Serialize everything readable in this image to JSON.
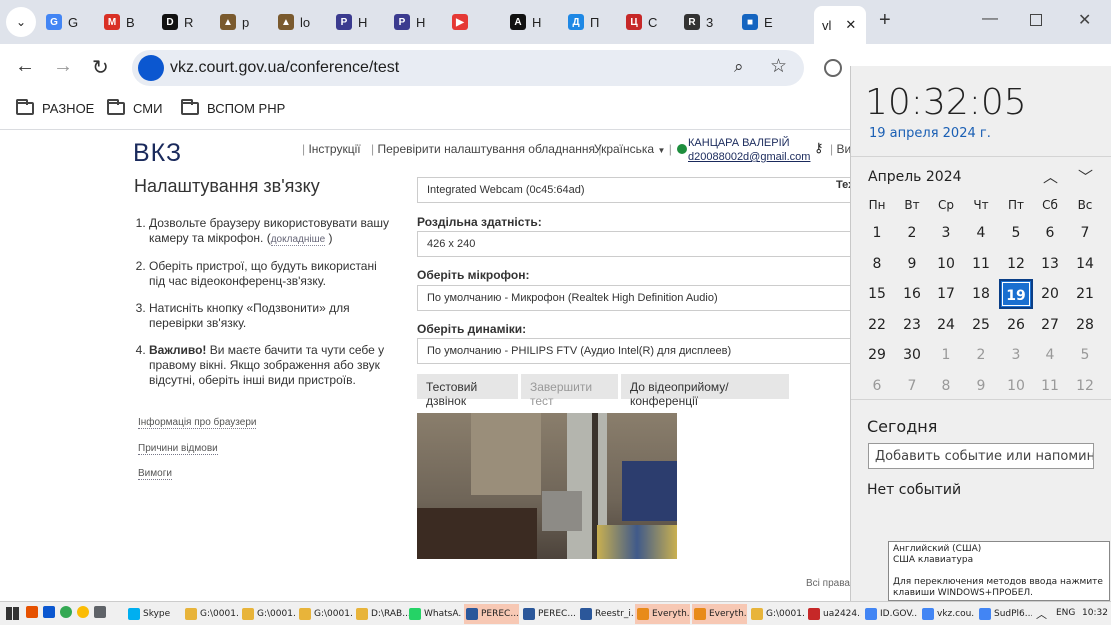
{
  "browser": {
    "tabs": [
      {
        "label": "G",
        "color": "#4285f4",
        "glyph": "G"
      },
      {
        "label": "B",
        "color": "#d93025",
        "glyph": "M"
      },
      {
        "label": "R",
        "color": "#111111",
        "glyph": "D"
      },
      {
        "label": "p",
        "color": "#7a5a2e",
        "glyph": "▲"
      },
      {
        "label": "lo",
        "color": "#7a5a2e",
        "glyph": "▲"
      },
      {
        "label": "H",
        "color": "#3b3b8f",
        "glyph": "P"
      },
      {
        "label": "H",
        "color": "#3b3b8f",
        "glyph": "P"
      },
      {
        "label": "",
        "color": "#e53935",
        "glyph": "▶"
      },
      {
        "label": "H",
        "color": "#111111",
        "glyph": "A"
      },
      {
        "label": "П",
        "color": "#1e88e5",
        "glyph": "Д"
      },
      {
        "label": "С",
        "color": "#c62828",
        "glyph": "Ц"
      },
      {
        "label": "3",
        "color": "#333333",
        "glyph": "R"
      },
      {
        "label": "Е",
        "color": "#1565c0",
        "glyph": "■"
      },
      {
        "label": "vl",
        "color": "#ffffff",
        "glyph": ""
      }
    ],
    "close_tab": "✕",
    "new_tab": "+",
    "url": "vkz.court.gov.ua/conference/test",
    "bookmarks": [
      "РАЗНОЕ",
      "СМИ",
      "ВСПОМ РНР"
    ]
  },
  "site": {
    "logo": "ВКЗ",
    "nav": [
      "Інструкції",
      "Перевірити налаштування обладнання",
      "Українська",
      "Ви"
    ],
    "user_name": "КАНЦАРА ВАЛЕРІЙ",
    "user_email": "d20088002d@gmail.com",
    "title": "Налаштування зв'язку",
    "steps": [
      {
        "text": "Дозвольте браузеру використовувати вашу камеру та мікрофон. (",
        "link": "докладніше",
        "tail": " )"
      },
      {
        "text": "Оберіть пристрої, що будуть використані під час відеоконференц-зв'язку."
      },
      {
        "text": "Натисніть кнопку «Подзвонити» для перевірки зв'язку."
      },
      {
        "bold": "Важливо!",
        "text": " Ви маєте бачити та чути себе у правому вікні. Якщо зображення або звук відсутні, оберіть інші види пристроїв."
      }
    ],
    "side_links": [
      "Інформація про браузери",
      "Причини відмови",
      "Вимоги"
    ],
    "camera_value": "Integrated Webcam (0c45:64ad)",
    "camera_side": "Тех",
    "resolution_label": "Роздільна здатність:",
    "resolution_value": "426 x 240",
    "mic_label": "Оберіть мікрофон:",
    "mic_value": "По умолчанию - Микрофон (Realtek High Definition Audio)",
    "speakers_label": "Оберіть динаміки:",
    "speakers_value": "По умолчанию - PHILIPS FTV (Аудио Intel(R) для дисплеев)",
    "buttons": [
      "Тестовий дзвінок",
      "Завершити тест",
      "До відеоприйому/конференції"
    ],
    "footer": "Всі права з"
  },
  "calendar": {
    "time": "10:32:05",
    "date": "19 апреля 2024 г.",
    "month": "Апрель 2024",
    "weekdays": [
      "Пн",
      "Вт",
      "Ср",
      "Чт",
      "Пт",
      "Сб",
      "Вс"
    ],
    "weeks": [
      [
        "1",
        "2",
        "3",
        "4",
        "5",
        "6",
        "7"
      ],
      [
        "8",
        "9",
        "10",
        "11",
        "12",
        "13",
        "14"
      ],
      [
        "15",
        "16",
        "17",
        "18",
        "19",
        "20",
        "21"
      ],
      [
        "22",
        "23",
        "24",
        "25",
        "26",
        "27",
        "28"
      ],
      [
        "29",
        "30",
        "1",
        "2",
        "3",
        "4",
        "5"
      ],
      [
        "6",
        "7",
        "8",
        "9",
        "10",
        "11",
        "12"
      ]
    ],
    "today": "19",
    "today_label": "Сегодня",
    "event_placeholder": "Добавить событие или напоминание",
    "no_events": "Нет событий"
  },
  "tooltip": {
    "line1": "Английский (США)",
    "line2": "США клавиатура",
    "line3": "Для переключения методов ввода нажмите клавиши WINDOWS+ПРОБЕЛ."
  },
  "taskbar": {
    "items": [
      {
        "label": "Skype",
        "color": "#00aff0"
      },
      {
        "label": "G:\\0001...",
        "color": "#e8b43a"
      },
      {
        "label": "G:\\0001...",
        "color": "#e8b43a"
      },
      {
        "label": "G:\\0001...",
        "color": "#e8b43a"
      },
      {
        "label": "D:\\RAB...",
        "color": "#e8b43a"
      },
      {
        "label": "WhatsA...",
        "color": "#25d366"
      },
      {
        "label": "PEREC...",
        "color": "#2b579a"
      },
      {
        "label": "PEREC...",
        "color": "#2b579a"
      },
      {
        "label": "Reestr_i...",
        "color": "#2b579a"
      },
      {
        "label": "Everyth...",
        "color": "#e88b1a"
      },
      {
        "label": "Everyth...",
        "color": "#e88b1a"
      },
      {
        "label": "G:\\0001...",
        "color": "#e8b43a"
      },
      {
        "label": "ua2424...",
        "color": "#c62828"
      },
      {
        "label": "ID.GOV...",
        "color": "#4285f4"
      },
      {
        "label": "vkz.cou...",
        "color": "#4285f4"
      },
      {
        "label": "SudPl6...",
        "color": "#4285f4"
      }
    ],
    "lang": "ENG",
    "clock": "10:32"
  }
}
